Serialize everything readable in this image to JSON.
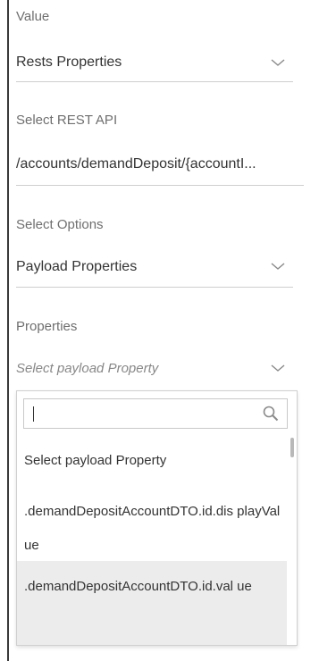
{
  "form": {
    "value": {
      "label": "Value",
      "selected": "Rests Properties"
    },
    "rest_api": {
      "label": "Select REST API",
      "selected": "/accounts/demandDeposit/{accountI..."
    },
    "options": {
      "label": "Select Options",
      "selected": "Payload Properties"
    },
    "properties": {
      "label": "Properties",
      "placeholder": "Select payload Property"
    }
  },
  "dropdown": {
    "search_value": "",
    "items": [
      {
        "text": "Select payload Property",
        "selected": false
      },
      {
        "text": ".demandDepositAccountDTO.id.dis playValue",
        "selected": false
      },
      {
        "text": ".demandDepositAccountDTO.id.val ue",
        "selected": true
      }
    ]
  },
  "icons": {
    "chevron": "chevron-down-icon",
    "search": "search-icon"
  },
  "colors": {
    "selected_item_bg": "#ececec",
    "label": "#6f6f6f",
    "underline": "#cfcfcf"
  }
}
